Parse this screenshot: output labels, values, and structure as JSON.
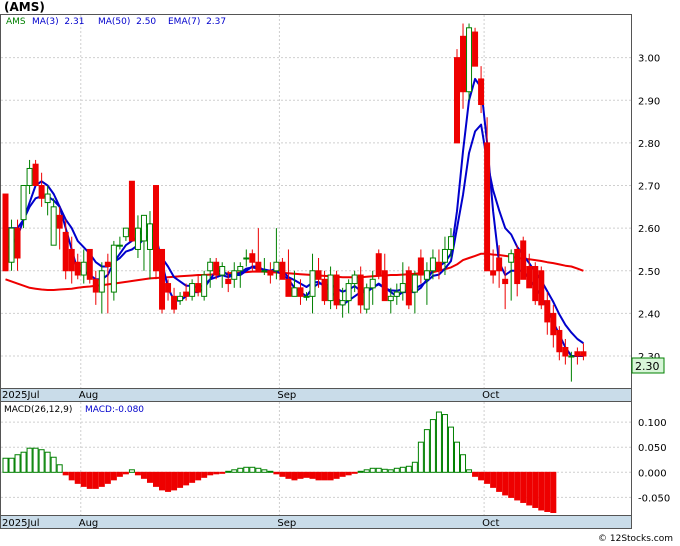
{
  "symbol": "(AMS)",
  "legend_main": {
    "ticker": "AMS",
    "ma3": "MA(3)  2.31",
    "ma50": "MA(50)  2.50",
    "ema7": "EMA(7)  2.37"
  },
  "legend_macd": {
    "name": "MACD(26,12,9)",
    "value": "MACD:-0.080"
  },
  "last_price_label": "2.30",
  "watermark": "© 12Stocks.com",
  "colors": {
    "up": "#008000",
    "down": "#ee0000",
    "ma3": "#0000cc",
    "ma50": "#ee0000",
    "ema7": "#0000cc",
    "axis_bar": "#c9dce9",
    "grid": "#cfcfcf",
    "price_box": "#d8f5d8"
  },
  "chart_data": {
    "type": "candlestick",
    "price_axis": {
      "ylim": [
        2.225,
        3.1
      ],
      "ticks": [
        2.3,
        2.4,
        2.5,
        2.6,
        2.7,
        2.8,
        2.9,
        3.0
      ],
      "tick_labels": [
        "2.30",
        "2.40",
        "2.50",
        "2.60",
        "2.70",
        "2.80",
        "2.90",
        "3.00"
      ]
    },
    "macd_axis": {
      "ylim": [
        -0.085,
        0.14
      ],
      "ticks": [
        0.1,
        0.05,
        0.0,
        -0.05
      ],
      "tick_labels": [
        "0.100",
        "0.050",
        "0.000",
        "-0.050"
      ]
    },
    "x_labels": [
      {
        "label": "2025Jul",
        "index": 0
      },
      {
        "label": "Aug",
        "index": 13
      },
      {
        "label": "Sep",
        "index": 46
      },
      {
        "label": "Oct",
        "index": 80
      }
    ],
    "candles": [
      [
        2.68,
        2.68,
        2.5,
        2.5
      ],
      [
        2.52,
        2.62,
        2.5,
        2.6
      ],
      [
        2.6,
        2.62,
        2.5,
        2.53
      ],
      [
        2.62,
        2.7,
        2.6,
        2.7
      ],
      [
        2.7,
        2.76,
        2.68,
        2.74
      ],
      [
        2.75,
        2.76,
        2.7,
        2.7
      ],
      [
        2.7,
        2.73,
        2.65,
        2.67
      ],
      [
        2.66,
        2.7,
        2.63,
        2.68
      ],
      [
        2.56,
        2.67,
        2.56,
        2.65
      ],
      [
        2.63,
        2.65,
        2.55,
        2.6
      ],
      [
        2.59,
        2.62,
        2.48,
        2.5
      ],
      [
        2.55,
        2.58,
        2.47,
        2.5
      ],
      [
        2.52,
        2.54,
        2.48,
        2.49
      ],
      [
        2.49,
        2.55,
        2.47,
        2.52
      ],
      [
        2.55,
        2.55,
        2.47,
        2.48
      ],
      [
        2.48,
        2.5,
        2.42,
        2.45
      ],
      [
        2.45,
        2.52,
        2.4,
        2.5
      ],
      [
        2.52,
        2.54,
        2.4,
        2.51
      ],
      [
        2.45,
        2.57,
        2.43,
        2.56
      ],
      [
        2.56,
        2.58,
        2.55,
        2.56
      ],
      [
        2.58,
        2.6,
        2.57,
        2.6
      ],
      [
        2.71,
        2.71,
        2.57,
        2.57
      ],
      [
        2.55,
        2.63,
        2.53,
        2.6
      ],
      [
        2.57,
        2.63,
        2.5,
        2.63
      ],
      [
        2.55,
        2.64,
        2.48,
        2.61
      ],
      [
        2.7,
        2.7,
        2.48,
        2.5
      ],
      [
        2.55,
        2.55,
        2.4,
        2.41
      ],
      [
        2.47,
        2.48,
        2.43,
        2.45
      ],
      [
        2.44,
        2.46,
        2.4,
        2.41
      ],
      [
        2.43,
        2.45,
        2.42,
        2.44
      ],
      [
        2.45,
        2.47,
        2.43,
        2.44
      ],
      [
        2.44,
        2.48,
        2.43,
        2.47
      ],
      [
        2.47,
        2.49,
        2.44,
        2.45
      ],
      [
        2.44,
        2.5,
        2.43,
        2.49
      ],
      [
        2.5,
        2.53,
        2.46,
        2.52
      ],
      [
        2.52,
        2.53,
        2.48,
        2.49
      ],
      [
        2.49,
        2.52,
        2.46,
        2.51
      ],
      [
        2.48,
        2.5,
        2.45,
        2.47
      ],
      [
        2.48,
        2.52,
        2.46,
        2.5
      ],
      [
        2.5,
        2.52,
        2.46,
        2.51
      ],
      [
        2.53,
        2.55,
        2.51,
        2.53
      ],
      [
        2.54,
        2.55,
        2.5,
        2.52
      ],
      [
        2.52,
        2.6,
        2.5,
        2.5
      ],
      [
        2.5,
        2.53,
        2.49,
        2.5
      ],
      [
        2.5,
        2.52,
        2.47,
        2.49
      ],
      [
        2.5,
        2.6,
        2.48,
        2.52
      ],
      [
        2.52,
        2.53,
        2.48,
        2.48
      ],
      [
        2.48,
        2.55,
        2.44,
        2.44
      ],
      [
        2.44,
        2.5,
        2.44,
        2.46
      ],
      [
        2.46,
        2.48,
        2.42,
        2.44
      ],
      [
        2.44,
        2.45,
        2.43,
        2.44
      ],
      [
        2.44,
        2.54,
        2.4,
        2.5
      ],
      [
        2.5,
        2.53,
        2.46,
        2.48
      ],
      [
        2.48,
        2.5,
        2.42,
        2.43
      ],
      [
        2.43,
        2.51,
        2.41,
        2.49
      ],
      [
        2.49,
        2.5,
        2.41,
        2.42
      ],
      [
        2.42,
        2.46,
        2.39,
        2.43
      ],
      [
        2.43,
        2.48,
        2.4,
        2.47
      ],
      [
        2.47,
        2.5,
        2.45,
        2.49
      ],
      [
        2.49,
        2.51,
        2.4,
        2.42
      ],
      [
        2.41,
        2.47,
        2.4,
        2.46
      ],
      [
        2.46,
        2.5,
        2.42,
        2.48
      ],
      [
        2.54,
        2.55,
        2.48,
        2.49
      ],
      [
        2.5,
        2.54,
        2.43,
        2.43
      ],
      [
        2.43,
        2.46,
        2.4,
        2.44
      ],
      [
        2.44,
        2.47,
        2.42,
        2.45
      ],
      [
        2.45,
        2.52,
        2.43,
        2.47
      ],
      [
        2.5,
        2.51,
        2.41,
        2.42
      ],
      [
        2.45,
        2.5,
        2.4,
        2.49
      ],
      [
        2.53,
        2.55,
        2.47,
        2.49
      ],
      [
        2.48,
        2.52,
        2.42,
        2.5
      ],
      [
        2.5,
        2.55,
        2.48,
        2.53
      ],
      [
        2.52,
        2.55,
        2.48,
        2.5
      ],
      [
        2.52,
        2.58,
        2.49,
        2.55
      ],
      [
        2.55,
        2.6,
        2.53,
        2.58
      ],
      [
        3.0,
        3.02,
        2.8,
        2.8
      ],
      [
        3.05,
        3.08,
        2.88,
        2.92
      ],
      [
        2.92,
        3.08,
        2.9,
        3.07
      ],
      [
        3.06,
        3.07,
        2.98,
        2.98
      ],
      [
        2.95,
        2.98,
        2.87,
        2.89
      ],
      [
        2.8,
        2.86,
        2.5,
        2.5
      ],
      [
        2.5,
        2.55,
        2.47,
        2.49
      ],
      [
        2.53,
        2.56,
        2.46,
        2.5
      ],
      [
        2.48,
        2.51,
        2.41,
        2.47
      ],
      [
        2.52,
        2.55,
        2.43,
        2.54
      ],
      [
        2.55,
        2.56,
        2.44,
        2.47
      ],
      [
        2.57,
        2.58,
        2.48,
        2.48
      ],
      [
        2.51,
        2.54,
        2.46,
        2.46
      ],
      [
        2.51,
        2.52,
        2.42,
        2.43
      ],
      [
        2.5,
        2.51,
        2.41,
        2.42
      ],
      [
        2.43,
        2.45,
        2.35,
        2.38
      ],
      [
        2.4,
        2.42,
        2.32,
        2.35
      ],
      [
        2.36,
        2.37,
        2.29,
        2.31
      ],
      [
        2.32,
        2.34,
        2.28,
        2.3
      ],
      [
        2.3,
        2.31,
        2.24,
        2.3
      ],
      [
        2.31,
        2.32,
        2.28,
        2.3
      ],
      [
        2.31,
        2.33,
        2.29,
        2.3
      ]
    ],
    "ma3": [
      2.55,
      2.56,
      2.58,
      2.62,
      2.66,
      2.7,
      2.71,
      2.7,
      2.68,
      2.65,
      2.6,
      2.55,
      2.5,
      2.5,
      2.49,
      2.48,
      2.48,
      2.49,
      2.52,
      2.54,
      2.56,
      2.57,
      2.58,
      2.6,
      2.61,
      2.58,
      2.52,
      2.46,
      2.43,
      2.43,
      2.44,
      2.45,
      2.45,
      2.46,
      2.48,
      2.5,
      2.5,
      2.49,
      2.49,
      2.49,
      2.5,
      2.51,
      2.51,
      2.5,
      2.5,
      2.5,
      2.49,
      2.48,
      2.46,
      2.45,
      2.44,
      2.46,
      2.47,
      2.47,
      2.45,
      2.44,
      2.42,
      2.43,
      2.44,
      2.45,
      2.45,
      2.46,
      2.47,
      2.46,
      2.45,
      2.44,
      2.45,
      2.45,
      2.45,
      2.46,
      2.48,
      2.5,
      2.51,
      2.52,
      2.54,
      2.64,
      2.78,
      2.9,
      2.95,
      2.93,
      2.8,
      2.64,
      2.52,
      2.49,
      2.5,
      2.5,
      2.5,
      2.48,
      2.46,
      2.44,
      2.41,
      2.38,
      2.35,
      2.32,
      2.3,
      2.3,
      2.3
    ],
    "ma50": [
      2.48,
      2.475,
      2.47,
      2.465,
      2.46,
      2.458,
      2.456,
      2.455,
      2.455,
      2.456,
      2.457,
      2.458,
      2.46,
      2.462,
      2.463,
      2.465,
      2.466,
      2.468,
      2.47,
      2.472,
      2.474,
      2.476,
      2.478,
      2.48,
      2.482,
      2.483,
      2.484,
      2.485,
      2.486,
      2.487,
      2.488,
      2.489,
      2.49,
      2.49,
      2.491,
      2.492,
      2.493,
      2.494,
      2.495,
      2.496,
      2.497,
      2.498,
      2.498,
      2.498,
      2.497,
      2.496,
      2.495,
      2.494,
      2.493,
      2.492,
      2.491,
      2.49,
      2.489,
      2.488,
      2.487,
      2.486,
      2.485,
      2.485,
      2.485,
      2.485,
      2.486,
      2.487,
      2.488,
      2.489,
      2.49,
      2.49,
      2.491,
      2.492,
      2.493,
      2.494,
      2.495,
      2.497,
      2.5,
      2.504,
      2.508,
      2.515,
      2.525,
      2.53,
      2.535,
      2.54,
      2.54,
      2.538,
      2.537,
      2.535,
      2.533,
      2.53,
      2.528,
      2.527,
      2.525,
      2.523,
      2.52,
      2.518,
      2.515,
      2.512,
      2.51,
      2.505,
      2.5
    ],
    "ema7": [
      2.6,
      2.6,
      2.6,
      2.62,
      2.65,
      2.67,
      2.675,
      2.675,
      2.665,
      2.65,
      2.62,
      2.6,
      2.57,
      2.555,
      2.54,
      2.52,
      2.51,
      2.51,
      2.52,
      2.53,
      2.545,
      2.55,
      2.56,
      2.575,
      2.585,
      2.565,
      2.53,
      2.51,
      2.485,
      2.475,
      2.465,
      2.465,
      2.46,
      2.467,
      2.48,
      2.485,
      2.49,
      2.485,
      2.49,
      2.495,
      2.505,
      2.508,
      2.505,
      2.503,
      2.5,
      2.505,
      2.5,
      2.485,
      2.478,
      2.47,
      2.462,
      2.472,
      2.474,
      2.463,
      2.47,
      2.458,
      2.451,
      2.456,
      2.464,
      2.453,
      2.455,
      2.461,
      2.468,
      2.459,
      2.454,
      2.453,
      2.457,
      2.448,
      2.458,
      2.466,
      2.475,
      2.488,
      2.491,
      2.505,
      2.523,
      2.6,
      2.678,
      2.776,
      2.827,
      2.843,
      2.757,
      2.689,
      2.642,
      2.6,
      2.585,
      2.556,
      2.537,
      2.518,
      2.496,
      2.477,
      2.452,
      2.427,
      2.398,
      2.373,
      2.355,
      2.34,
      2.33
    ],
    "macd_hist": [
      0.028,
      0.028,
      0.035,
      0.04,
      0.048,
      0.048,
      0.045,
      0.04,
      0.03,
      0.015,
      -0.005,
      -0.015,
      -0.022,
      -0.028,
      -0.032,
      -0.032,
      -0.028,
      -0.022,
      -0.015,
      -0.008,
      -0.003,
      0.005,
      -0.005,
      -0.012,
      -0.02,
      -0.028,
      -0.035,
      -0.038,
      -0.035,
      -0.03,
      -0.025,
      -0.02,
      -0.015,
      -0.01,
      -0.005,
      -0.003,
      -0.002,
      0.002,
      0.005,
      0.008,
      0.01,
      0.01,
      0.008,
      0.005,
      0.002,
      -0.003,
      -0.008,
      -0.012,
      -0.015,
      -0.012,
      -0.01,
      -0.012,
      -0.015,
      -0.015,
      -0.015,
      -0.012,
      -0.008,
      -0.005,
      -0.002,
      0.002,
      0.005,
      0.008,
      0.008,
      0.006,
      0.005,
      0.008,
      0.01,
      0.012,
      0.02,
      0.06,
      0.085,
      0.105,
      0.12,
      0.115,
      0.09,
      0.06,
      0.035,
      0.005,
      -0.008,
      -0.015,
      -0.022,
      -0.03,
      -0.038,
      -0.045,
      -0.05,
      -0.055,
      -0.06,
      -0.065,
      -0.07,
      -0.075,
      -0.078,
      -0.08
    ]
  }
}
